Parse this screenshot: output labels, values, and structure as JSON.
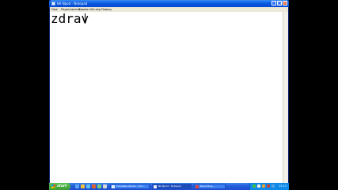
{
  "window": {
    "title": "Nē Ņpod - Notepad",
    "menu": [
      "Fase",
      "Редактирате",
      "Формат",
      "Изглед",
      "Помощ"
    ]
  },
  "editor": {
    "content": "zdrav"
  },
  "taskbar": {
    "start_label": "start",
    "buttons": [
      {
        "label": "Camtasia Studio - Unt..."
      },
      {
        "label": "Nē Ņpod - Notepad"
      },
      {
        "label": "Recording..."
      }
    ],
    "clock": "12:11"
  },
  "colors": {
    "titlebar": "#0a5be0",
    "taskbar": "#245edb",
    "start": "#3a9b34",
    "close": "#d9512c"
  }
}
